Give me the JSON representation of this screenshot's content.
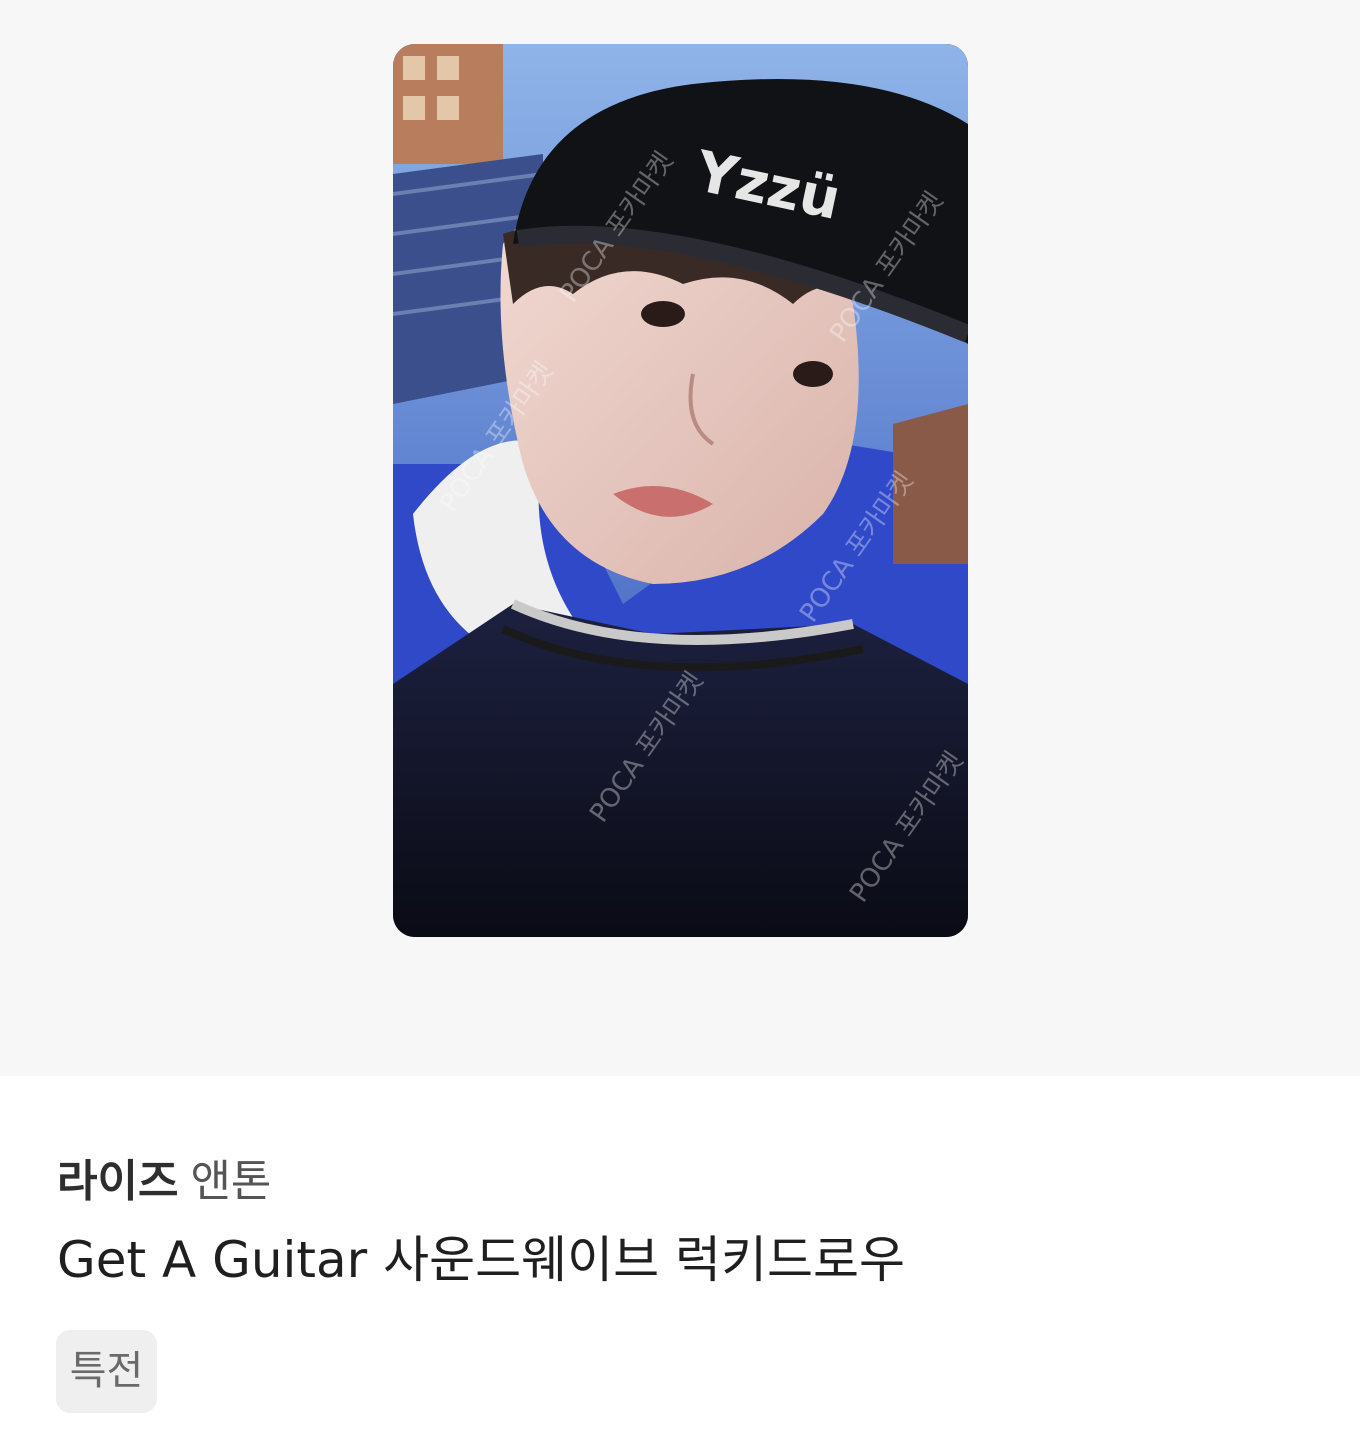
{
  "product": {
    "group": "라이즈",
    "member": "앤톤",
    "title": "Get A Guitar 사운드웨이브 럭키드로우",
    "tag": "특전"
  },
  "photo": {
    "beanie_text": "Yzzü",
    "watermark_text": "POCA 포카마켓"
  },
  "colors": {
    "hero_background": "#f7f7f7",
    "tag_background": "#efefef",
    "title_text": "#1f1f1f"
  }
}
